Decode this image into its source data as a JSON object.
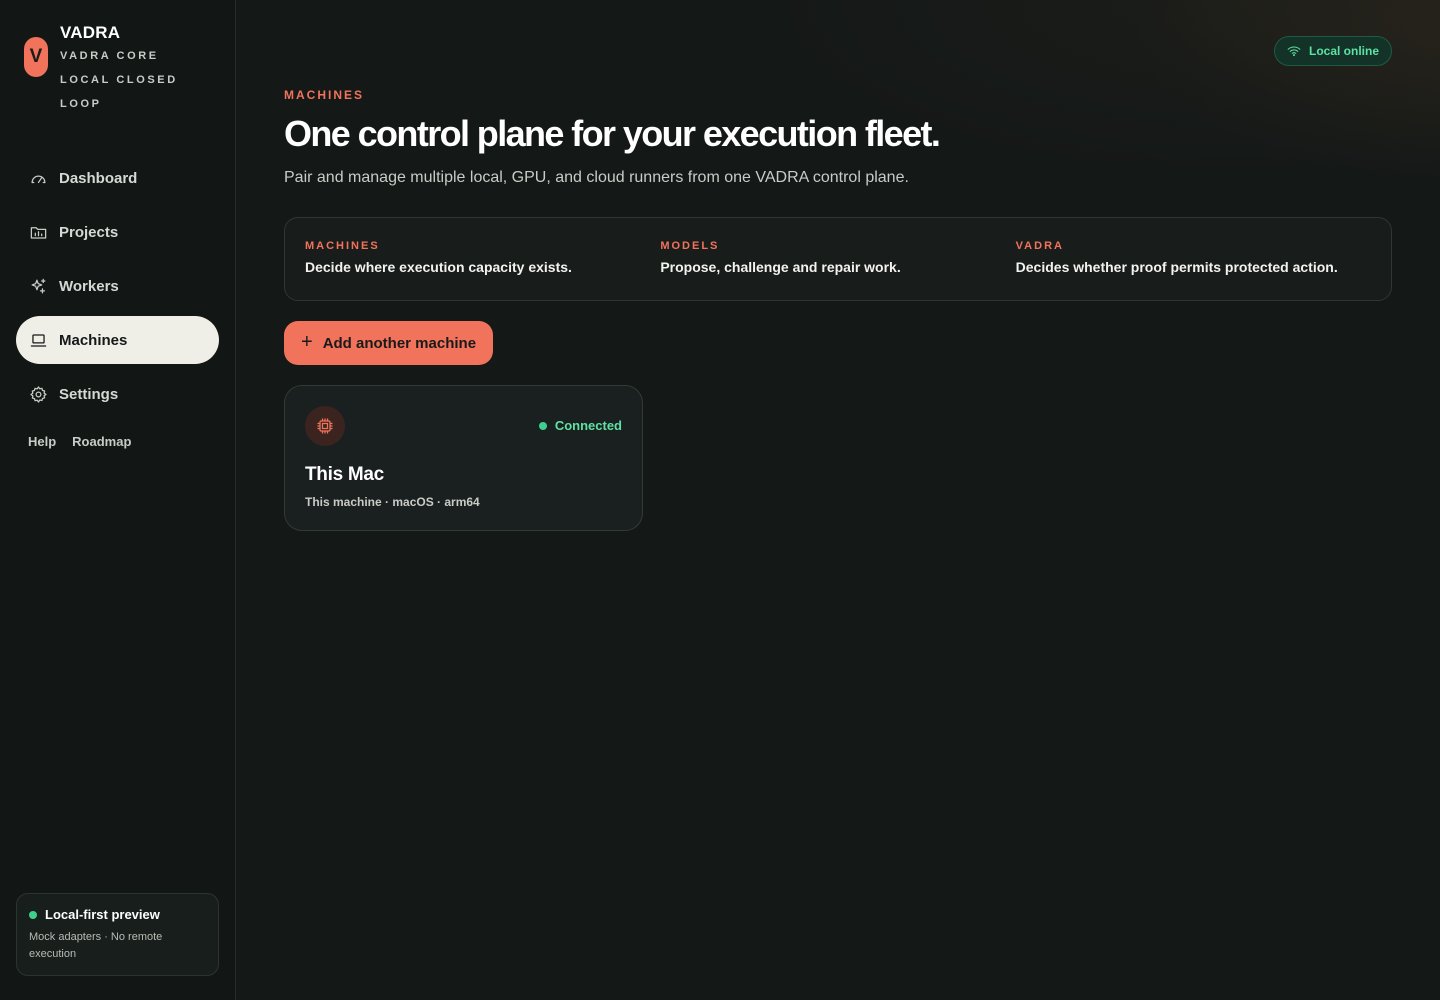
{
  "brand": {
    "initial": "V",
    "name": "VADRA",
    "subtitle": "VADRA CORE LOCAL CLOSED LOOP"
  },
  "sidebar": {
    "items": [
      {
        "label": "Dashboard",
        "icon": "gauge-icon",
        "active": false
      },
      {
        "label": "Projects",
        "icon": "folder-chart-icon",
        "active": false
      },
      {
        "label": "Workers",
        "icon": "sparkles-icon",
        "active": false
      },
      {
        "label": "Machines",
        "icon": "laptop-icon",
        "active": true
      },
      {
        "label": "Settings",
        "icon": "gear-icon",
        "active": false
      }
    ],
    "links": {
      "help": "Help",
      "roadmap": "Roadmap"
    },
    "preview": {
      "title": "Local-first preview",
      "description": "Mock adapters · No remote execution"
    }
  },
  "status": {
    "label": "Local online",
    "icon": "wifi-icon",
    "color": "#5fe0a4"
  },
  "header": {
    "eyebrow": "MACHINES",
    "title": "One control plane for your execution fleet.",
    "subtitle": "Pair and manage multiple local, GPU, and cloud runners from one VADRA control plane."
  },
  "info_strip": [
    {
      "label": "MACHINES",
      "text": "Decide where execution capacity exists."
    },
    {
      "label": "MODELS",
      "text": "Propose, challenge and repair work."
    },
    {
      "label": "VADRA",
      "text": "Decides whether proof permits protected action."
    }
  ],
  "actions": {
    "add_machine_label": "Add another machine"
  },
  "machines": [
    {
      "name": "This Mac",
      "meta": "This machine · macOS · arm64",
      "status": "Connected",
      "icon": "cpu-chip-icon"
    }
  ],
  "colors": {
    "accent": "#f2735b",
    "success": "#3ecf8e",
    "background": "#141817"
  }
}
